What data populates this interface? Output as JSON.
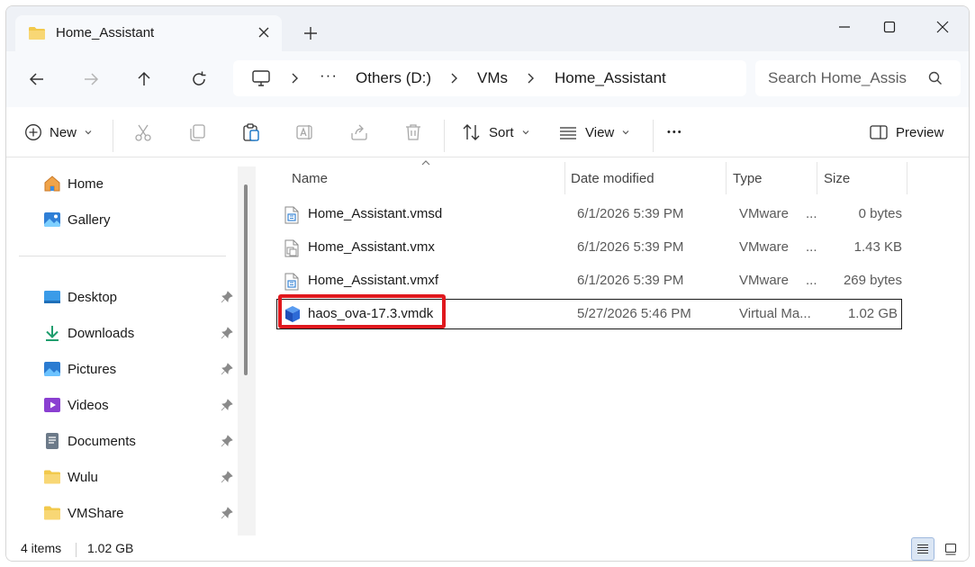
{
  "tab": {
    "title": "Home_Assistant"
  },
  "address": {
    "ellipsis": "···",
    "crumbs": [
      "Others (D:)",
      "VMs",
      "Home_Assistant"
    ]
  },
  "search": {
    "placeholder": "Search Home_Assis"
  },
  "toolbar": {
    "new_label": "New",
    "sort_label": "Sort",
    "view_label": "View",
    "more_label": "•••",
    "preview_label": "Preview"
  },
  "sidebar": {
    "top": [
      {
        "label": "Home",
        "icon": "home-icon"
      },
      {
        "label": "Gallery",
        "icon": "gallery-icon"
      }
    ],
    "pinned": [
      {
        "label": "Desktop",
        "icon": "desktop-icon"
      },
      {
        "label": "Downloads",
        "icon": "downloads-icon"
      },
      {
        "label": "Pictures",
        "icon": "pictures-icon"
      },
      {
        "label": "Videos",
        "icon": "videos-icon"
      },
      {
        "label": "Documents",
        "icon": "documents-icon"
      },
      {
        "label": "Wulu",
        "icon": "folder-icon"
      },
      {
        "label": "VMShare",
        "icon": "folder-icon"
      }
    ]
  },
  "columns": {
    "name": "Name",
    "date": "Date modified",
    "type": "Type",
    "size": "Size"
  },
  "files": [
    {
      "name": "Home_Assistant.vmsd",
      "date": "6/1/2026 5:39 PM",
      "type": "VMware",
      "type_more": "...",
      "size": "0 bytes",
      "icon": "vmsd-file-icon"
    },
    {
      "name": "Home_Assistant.vmx",
      "date": "6/1/2026 5:39 PM",
      "type": "VMware",
      "type_more": "...",
      "size": "1.43 KB",
      "icon": "vmx-file-icon"
    },
    {
      "name": "Home_Assistant.vmxf",
      "date": "6/1/2026 5:39 PM",
      "type": "VMware",
      "type_more": "...",
      "size": "269 bytes",
      "icon": "vmxf-file-icon"
    },
    {
      "name": "haos_ova-17.3.vmdk",
      "date": "5/27/2026 5:46 PM",
      "type": "Virtual Ma...",
      "type_more": "",
      "size": "1.02 GB",
      "icon": "vmdk-disk-icon",
      "selected": true
    }
  ],
  "status": {
    "count": "4 items",
    "selection_size": "1.02 GB"
  },
  "colors": {
    "highlight": "#e0191e",
    "folder": "#f2c94c",
    "accent": "#0067c0"
  }
}
